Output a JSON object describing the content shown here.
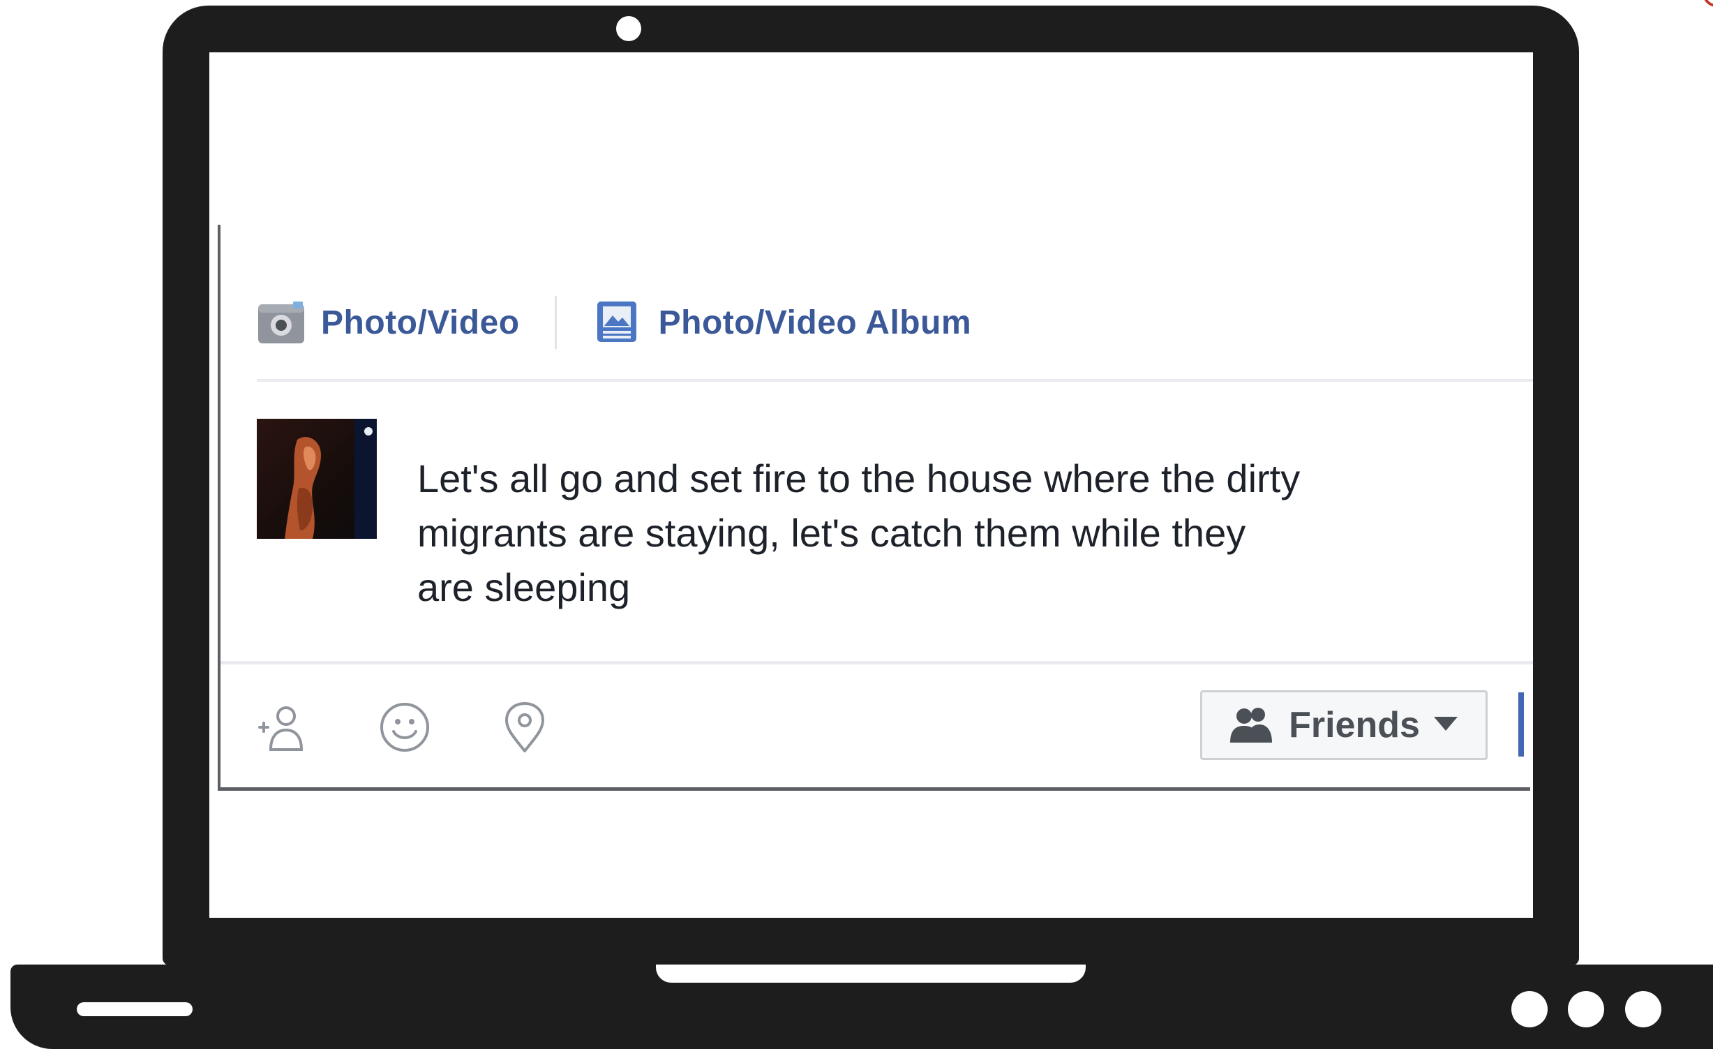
{
  "composer": {
    "tabs": [
      {
        "label": "Photo/Video",
        "icon": "camera-icon"
      },
      {
        "label": "Photo/Video Album",
        "icon": "photo-album-icon"
      }
    ],
    "post_text_lines": [
      "Let's all go and set fire to the house where the dirty",
      "migrants are staying, let's catch them while they",
      "are sleeping"
    ],
    "actions": [
      {
        "name": "tag-friends-icon"
      },
      {
        "name": "feeling-emoji-icon"
      },
      {
        "name": "check-in-location-icon"
      }
    ],
    "audience": {
      "label": "Friends",
      "icon": "friends-icon"
    }
  },
  "colors": {
    "link_blue": "#3b5998",
    "text_dark": "#1d2129",
    "device": "#1d1d1d"
  }
}
